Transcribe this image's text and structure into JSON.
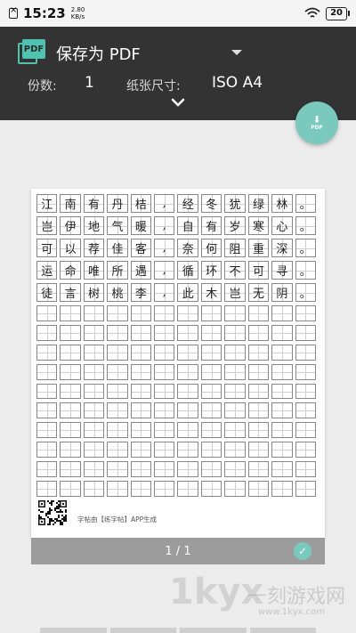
{
  "status_bar": {
    "time": "15:23",
    "net_speed_value": "2.80",
    "net_speed_unit": "KB/s",
    "battery": "20"
  },
  "header": {
    "destination": "保存为 PDF",
    "copies_label": "份数:",
    "copies_value": "1",
    "paper_label": "纸张尺寸:",
    "paper_value": "ISO A4"
  },
  "fab": {
    "label": "PDF"
  },
  "logo": {
    "text": "PDF"
  },
  "copybook": {
    "rows": [
      [
        "江",
        "南",
        "有",
        "丹",
        "桔",
        ",",
        "经",
        "冬",
        "犹",
        "绿",
        "林",
        "。"
      ],
      [
        "岂",
        "伊",
        "地",
        "气",
        "暖",
        ",",
        "自",
        "有",
        "岁",
        "寒",
        "心",
        "。"
      ],
      [
        "可",
        "以",
        "荐",
        "佳",
        "客",
        ",",
        "奈",
        "何",
        "阻",
        "重",
        "深",
        "。"
      ],
      [
        "运",
        "命",
        "唯",
        "所",
        "遇",
        ",",
        "循",
        "环",
        "不",
        "可",
        "寻",
        "。"
      ],
      [
        "徒",
        "言",
        "树",
        "桃",
        "李",
        ",",
        "此",
        "木",
        "岂",
        "无",
        "阴",
        "。"
      ]
    ],
    "total_rows": 15,
    "columns": 12,
    "credit": "字帖由【练字帖】APP生成"
  },
  "pager": {
    "text": "1 / 1"
  },
  "watermark": {
    "logo": "1kyx",
    "name": "一刻游戏网",
    "url": "www.1kyx.com"
  }
}
